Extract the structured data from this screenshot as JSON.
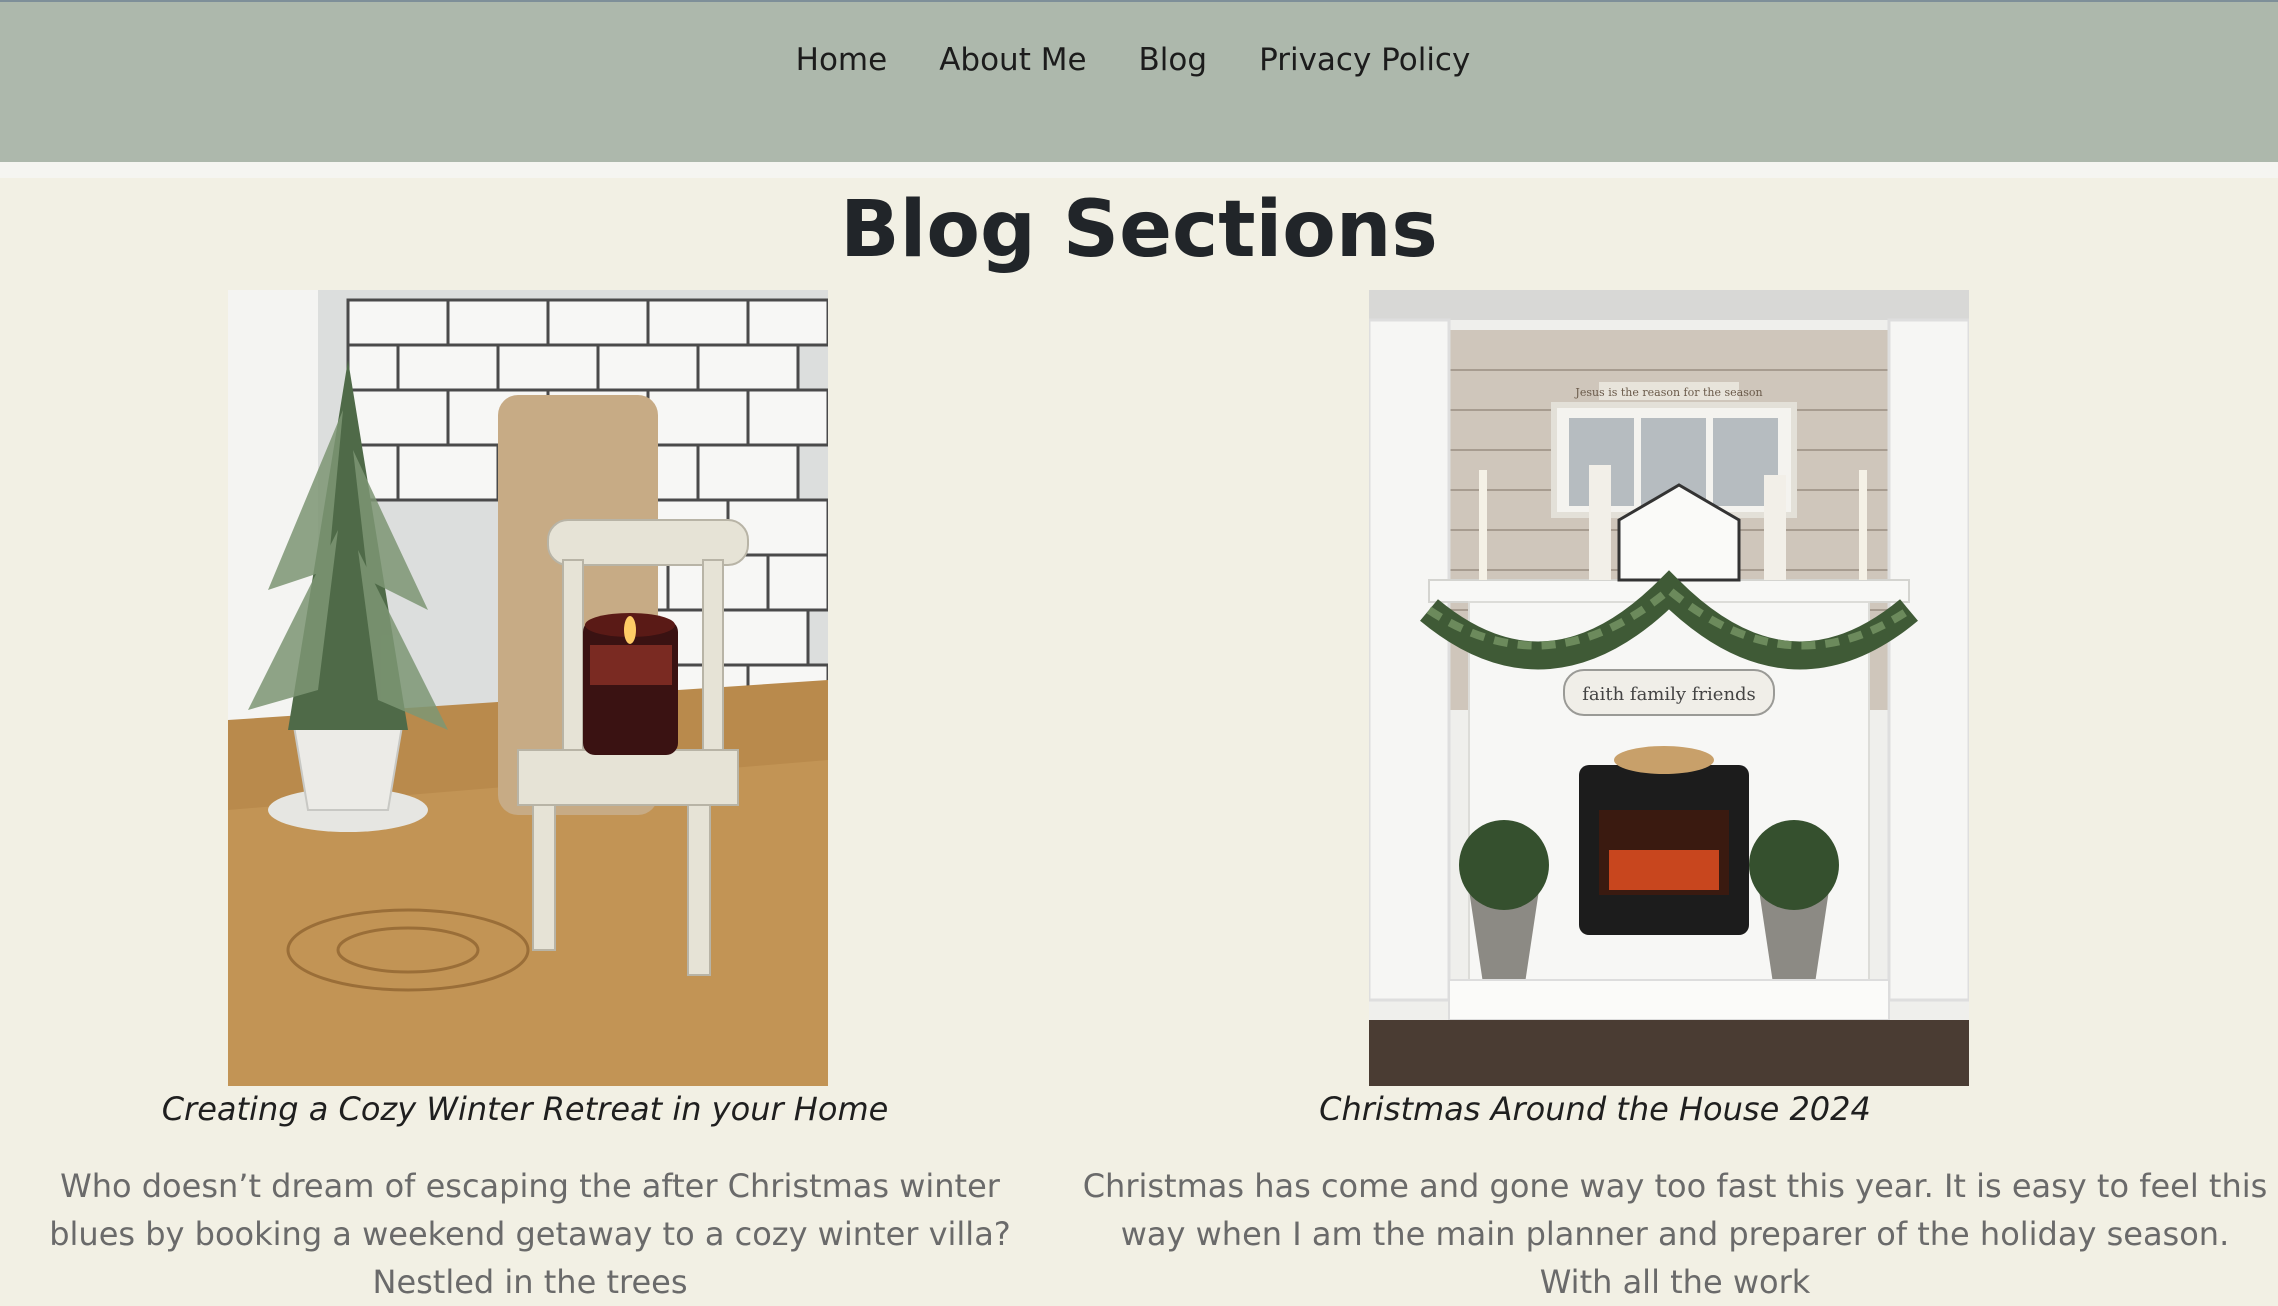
{
  "nav": {
    "items": [
      {
        "label": "Home"
      },
      {
        "label": "About Me"
      },
      {
        "label": "Blog"
      },
      {
        "label": "Privacy Policy"
      }
    ]
  },
  "page": {
    "title": "Blog Sections"
  },
  "posts": [
    {
      "image_icon": "photo-candle-chair-icon",
      "caption": "Creating a Cozy Winter Retreat in your Home",
      "excerpt": "Who doesn’t dream of escaping the after Christmas winter blues by booking a weekend getaway to a cozy winter villa? Nestled in the trees"
    },
    {
      "image_icon": "photo-christmas-fireplace-icon",
      "caption": "Christmas Around the House 2024",
      "excerpt": "Christmas has come and gone way too fast this year. It is easy to feel this way when I am the main planner and preparer of the holiday season. With all the work",
      "sign_text": "faith family friends",
      "top_sign_text": "Jesus is the reason for the season"
    }
  ],
  "colors": {
    "navbar": "#adb8ac",
    "background": "#f2f0e4",
    "title": "#212529",
    "excerpt": "#6a6a6a"
  }
}
